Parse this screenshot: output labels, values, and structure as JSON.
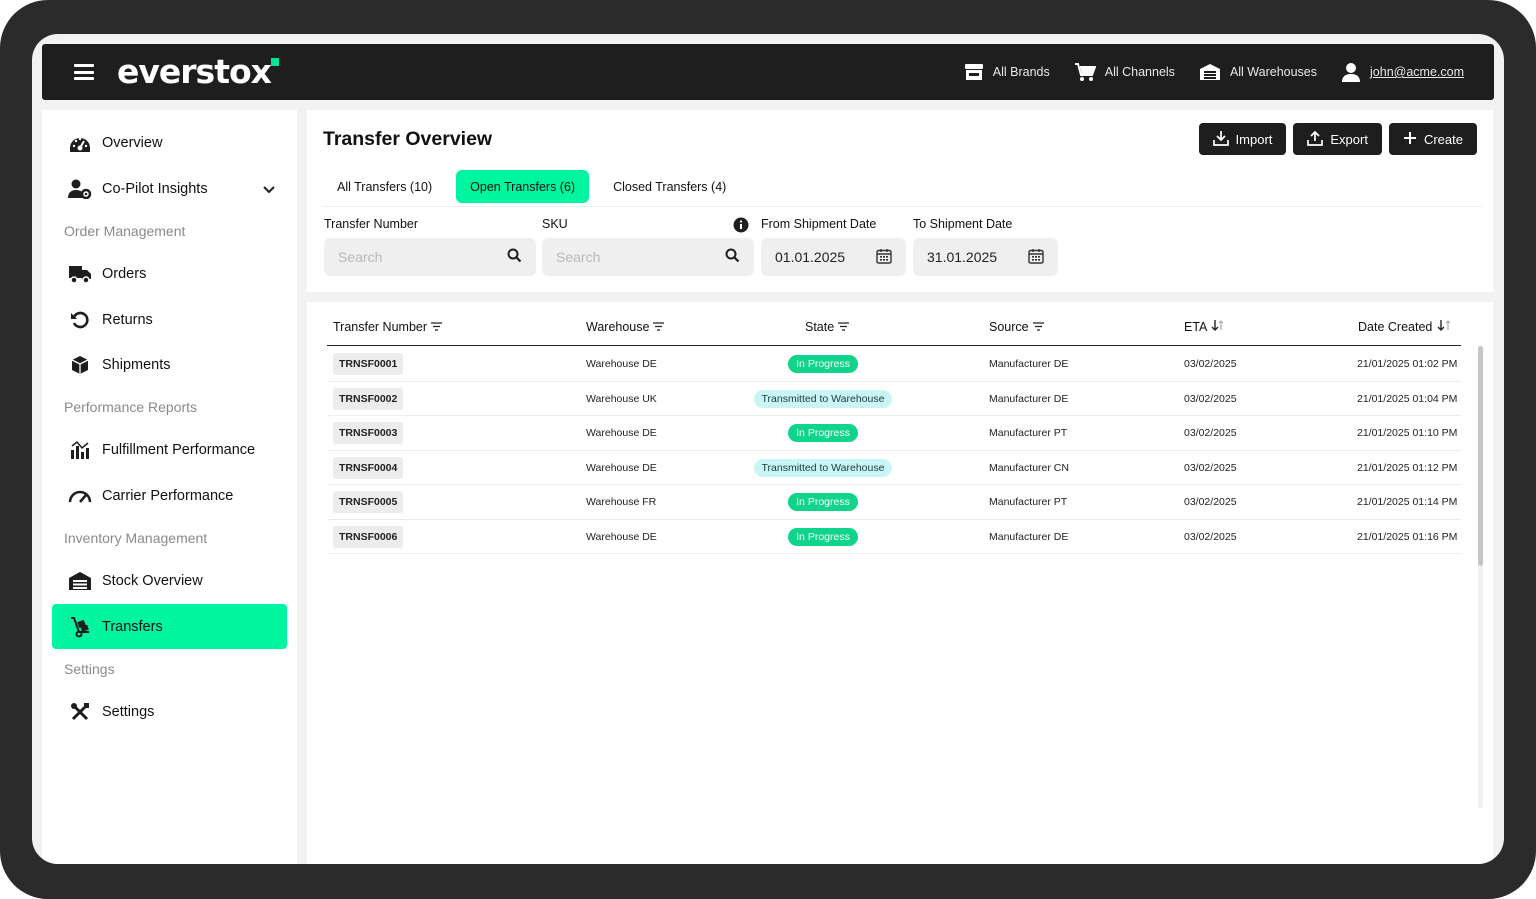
{
  "app": {
    "logo": "everstox",
    "accent": "#00f5a0"
  },
  "topnav": {
    "brands": "All Brands",
    "channels": "All Channels",
    "warehouses": "All Warehouses",
    "user": "john@acme.com"
  },
  "sidebar": {
    "overview": "Overview",
    "copilot": "Co-Pilot Insights",
    "order_section": "Order Management",
    "orders": "Orders",
    "returns": "Returns",
    "shipments": "Shipments",
    "performance_section": "Performance Reports",
    "fulfillment": "Fulfillment Performance",
    "carrier": "Carrier Performance",
    "inventory_section": "Inventory Management",
    "stock": "Stock Overview",
    "transfers": "Transfers",
    "settings_section": "Settings",
    "settings": "Settings"
  },
  "page": {
    "title": "Transfer Overview",
    "import": "Import",
    "export": "Export",
    "create": "Create"
  },
  "tabs": {
    "all": "All Transfers (10)",
    "open": "Open Transfers (6)",
    "closed": "Closed Transfers (4)"
  },
  "filters": {
    "transfer_number_label": "Transfer Number",
    "transfer_number_placeholder": "Search",
    "sku_label": "SKU",
    "sku_placeholder": "Search",
    "from_label": "From Shipment Date",
    "from_value": "01.01.2025",
    "to_label": "To Shipment Date",
    "to_value": "31.01.2025"
  },
  "table": {
    "headers": {
      "transfer_number": "Transfer Number",
      "warehouse": "Warehouse",
      "state": "State",
      "source": "Source",
      "eta": "ETA",
      "date_created": "Date Created"
    },
    "rows": [
      {
        "id": "TRNSF0001",
        "warehouse": "Warehouse DE",
        "state": "In Progress",
        "source": "Manufacturer DE",
        "eta": "03/02/2025",
        "created": "21/01/2025 01:02 PM"
      },
      {
        "id": "TRNSF0002",
        "warehouse": "Warehouse UK",
        "state": "Transmitted to Warehouse",
        "source": "Manufacturer DE",
        "eta": "03/02/2025",
        "created": "21/01/2025 01:04 PM"
      },
      {
        "id": "TRNSF0003",
        "warehouse": "Warehouse DE",
        "state": "In Progress",
        "source": "Manufacturer PT",
        "eta": "03/02/2025",
        "created": "21/01/2025 01:10 PM"
      },
      {
        "id": "TRNSF0004",
        "warehouse": "Warehouse DE",
        "state": "Transmitted to Warehouse",
        "source": "Manufacturer CN",
        "eta": "03/02/2025",
        "created": "21/01/2025 01:12 PM"
      },
      {
        "id": "TRNSF0005",
        "warehouse": "Warehouse FR",
        "state": "In Progress",
        "source": "Manufacturer PT",
        "eta": "03/02/2025",
        "created": "21/01/2025 01:14 PM"
      },
      {
        "id": "TRNSF0006",
        "warehouse": "Warehouse DE",
        "state": "In Progress",
        "source": "Manufacturer DE",
        "eta": "03/02/2025",
        "created": "21/01/2025 01:16 PM"
      }
    ]
  }
}
